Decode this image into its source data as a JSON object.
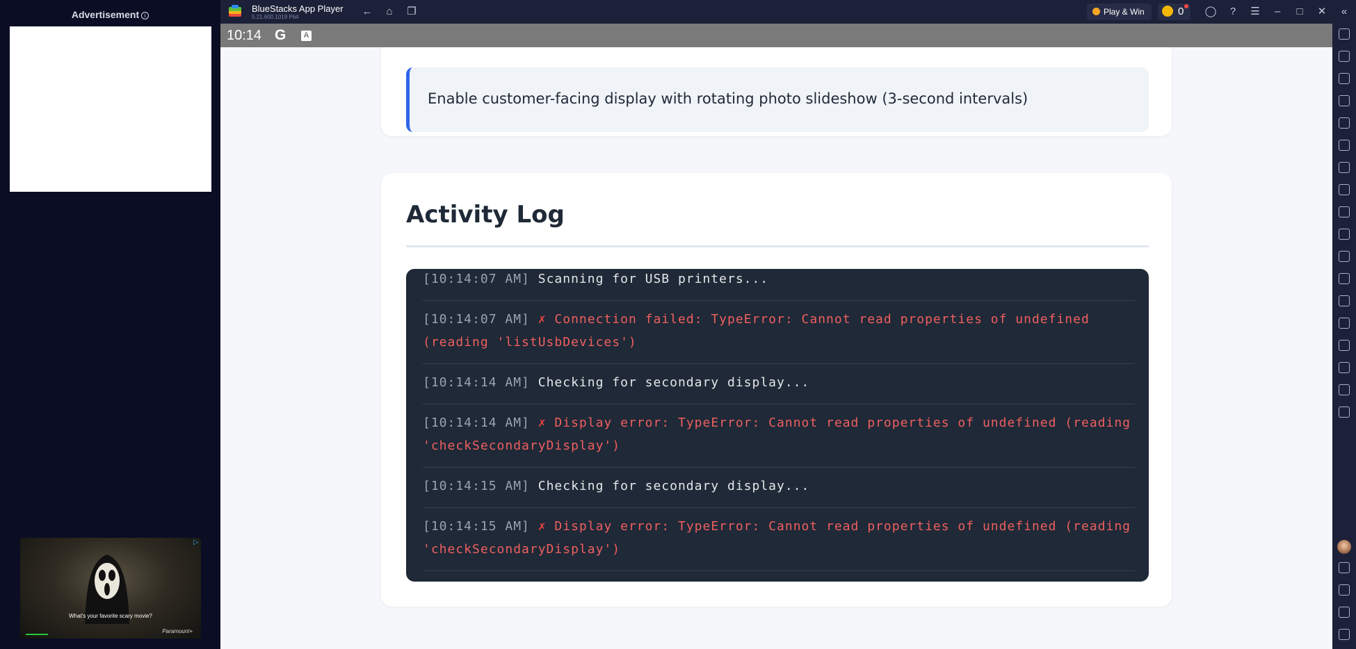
{
  "ad_panel": {
    "label": "Advertisement",
    "info_glyph": "i",
    "video_ad": {
      "caption": "What's your favorite scary movie?",
      "brand": "Paramount+"
    }
  },
  "titlebar": {
    "app_name": "BlueStacks App Player",
    "version": "5.21.600.1019  P64",
    "play_win_label": "Play & Win",
    "coin_count": "0"
  },
  "statusbar": {
    "time": "10:14",
    "google_glyph": "G",
    "a_glyph": "A"
  },
  "settings_card": {
    "info_text": "Enable customer-facing display with rotating photo slideshow (3-second intervals)"
  },
  "activity_log": {
    "title": "Activity Log",
    "entries": [
      {
        "time": "[10:14:07 AM]",
        "mark": "",
        "message": "Scanning for USB printers...",
        "status": "info"
      },
      {
        "time": "[10:14:07 AM]",
        "mark": "✗",
        "message": "Connection failed: TypeError: Cannot read properties of undefined (reading 'listUsbDevices')",
        "status": "error"
      },
      {
        "time": "[10:14:14 AM]",
        "mark": "",
        "message": "Checking for secondary display...",
        "status": "info"
      },
      {
        "time": "[10:14:14 AM]",
        "mark": "✗",
        "message": "Display error: TypeError: Cannot read properties of undefined (reading 'checkSecondaryDisplay')",
        "status": "error"
      },
      {
        "time": "[10:14:15 AM]",
        "mark": "",
        "message": "Checking for secondary display...",
        "status": "info"
      },
      {
        "time": "[10:14:15 AM]",
        "mark": "✗",
        "message": "Display error: TypeError: Cannot read properties of undefined (reading 'checkSecondaryDisplay')",
        "status": "error"
      }
    ]
  },
  "colors": {
    "accent": "#2f66e8",
    "error": "#ef5f5f",
    "console_bg": "#1f2937",
    "chrome_bg": "#1c2139"
  }
}
